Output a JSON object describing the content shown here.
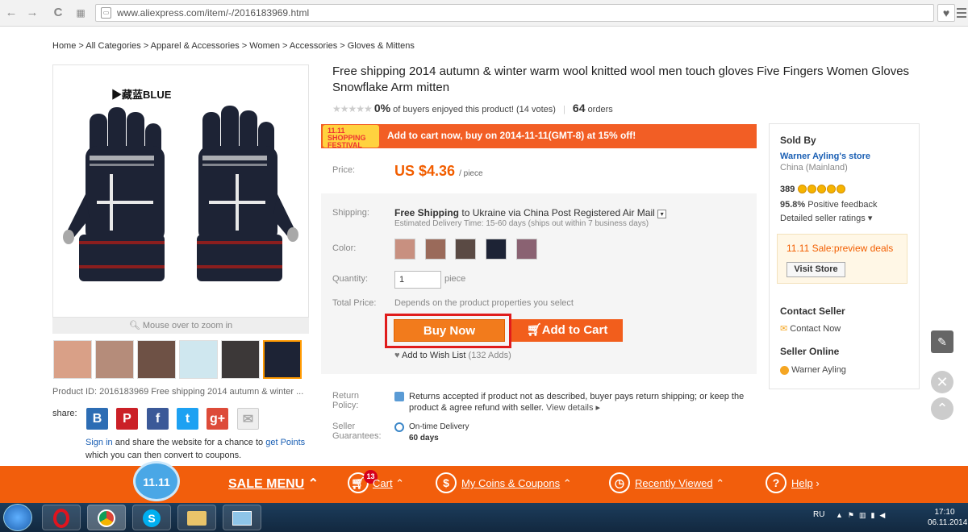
{
  "browser": {
    "url": "www.aliexpress.com/item/-/2016183969.html"
  },
  "breadcrumb": "Home > All Categories > Apparel & Accessories > Women > Accessories > Gloves & Mittens",
  "image": {
    "color_tag": "▶藏蓝BLUE",
    "zoom_hint": "Mouse over to zoom in"
  },
  "product": {
    "id_line": "Product ID: 2016183969 Free shipping 2014 autumn & winter ...",
    "title": "Free shipping 2014 autumn & winter warm wool knitted wool men touch gloves Five Fingers Women Gloves Snowflake Arm mitten",
    "rating_pct": "0%",
    "rating_text": "of buyers enjoyed this product! (14 votes)",
    "orders_count": "64",
    "orders_label": "orders",
    "promo_badge": "11.11 SHOPPING FESTIVAL",
    "promo_text": "Add to cart now, buy on 2014-11-11(GMT-8) at 15% off!",
    "price_label": "Price:",
    "price": "US $4.36",
    "price_unit": "/ piece",
    "shipping_label": "Shipping:",
    "shipping_free": "Free Shipping",
    "shipping_to": "to  Ukraine via China Post Registered Air Mail",
    "shipping_est": "Estimated Delivery Time: 15-60 days (ships out within 7 business days)",
    "color_label": "Color:",
    "quantity_label": "Quantity:",
    "quantity_value": "1",
    "quantity_unit": "piece",
    "total_label": "Total Price:",
    "total_text": "Depends on the product properties you select",
    "buy_now": "Buy Now",
    "add_to_cart": "Add to Cart",
    "wish_text": "Add to Wish List",
    "wish_count": "(132 Adds)",
    "return_label": "Return Policy:",
    "return_text": "Returns accepted if product not as described, buyer pays return shipping; or keep the product & agree refund with seller.",
    "view_details": "View details",
    "guarantee_label": "Seller Guarantees:",
    "guarantee_title": "On-time Delivery",
    "guarantee_days": "60 days"
  },
  "share": {
    "label": "share:",
    "sign_in": "Sign in",
    "text1": "and share the website for a chance to",
    "points": "get Points",
    "text2": "which you can then convert to coupons."
  },
  "seller": {
    "sold_by": "Sold By",
    "store": "Warner Ayling's store",
    "country": "China (Mainland)",
    "score": "389",
    "feedback_pct": "95.8%",
    "feedback_text": "Positive feedback",
    "detailed": "Detailed seller ratings",
    "deal_text": "11.11 Sale:preview deals",
    "visit_store": "Visit Store",
    "contact_title": "Contact Seller",
    "contact_now": "Contact Now",
    "online_title": "Seller Online",
    "online_name": "Warner Ayling"
  },
  "bottom": {
    "badge": "11.11",
    "sale_menu": "SALE MENU",
    "cart_count": "13",
    "cart": "Cart",
    "coins": "My Coins & Coupons",
    "recent": "Recently Viewed",
    "help": "Help"
  },
  "taskbar": {
    "lang": "RU",
    "time": "17:10",
    "date": "06.11.2014"
  },
  "colors": {
    "accent": "#f25e0c",
    "price": "#f25e00",
    "link": "#1a5fb4"
  }
}
